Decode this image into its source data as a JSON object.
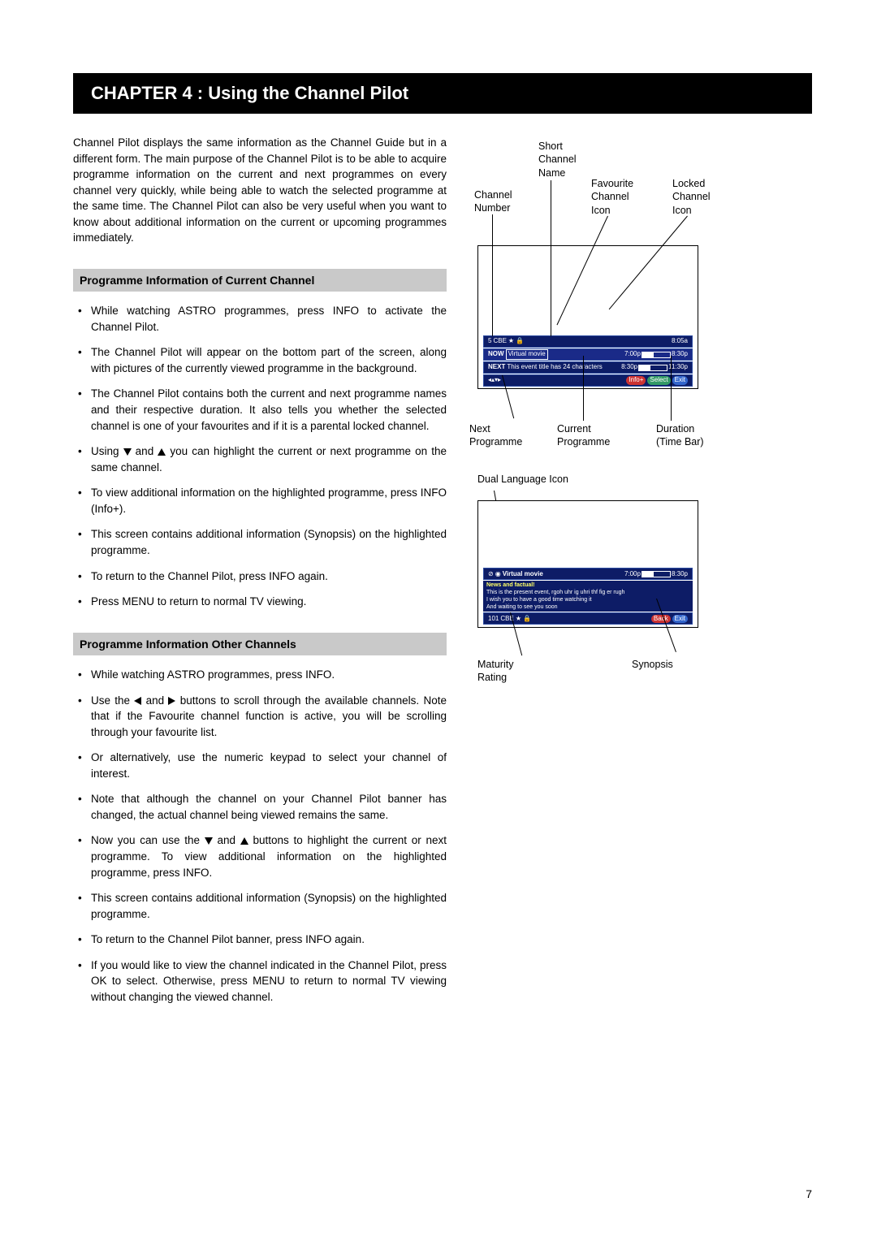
{
  "chapter_title": "CHAPTER 4 : Using the Channel Pilot",
  "intro": "Channel Pilot displays the same information as the Channel Guide but in a different form.  The main purpose of the Channel Pilot is to be able to acquire programme information on the current and next programmes on every channel very quickly, while being able to watch the selected programme at the same time.  The Channel Pilot can also be very useful when you want to know about additional information on the current or upcoming programmes immediately.",
  "section1_title": "Programme Information of Current Channel",
  "section1_items": {
    "i0": "While watching ASTRO programmes, press INFO to activate the Channel Pilot.",
    "i1": "The Channel Pilot will appear on the bottom part of the screen, along with pictures of the currently viewed programme in the background.",
    "i2": "The Channel Pilot contains both the current and next programme names and their respective duration.  It also tells you whether the selected channel is one of your favourites and if it is a parental locked channel.",
    "i3a": "Using ",
    "i3b": " and ",
    "i3c": " you can highlight the current or next programme on the same channel.",
    "i4": "To view additional information on the highlighted programme, press INFO (Info+).",
    "i5": "This screen contains additional information (Synopsis) on the highlighted programme.",
    "i6": "To return to the Channel Pilot, press INFO again.",
    "i7": "Press MENU to return to normal TV viewing."
  },
  "section2_title": "Programme Information Other Channels",
  "section2_items": {
    "i0": "While watching ASTRO programmes, press INFO.",
    "i1a": "Use the  ",
    "i1b": "  and  ",
    "i1c": "  buttons to scroll through the available channels.  Note that if the Favourite channel function is active, you will be scrolling through your favourite list.",
    "i2": "Or alternatively, use the numeric keypad to select your channel of interest.",
    "i3": "Note that although the channel on your Channel Pilot banner has changed, the actual channel being viewed remains the same.",
    "i4a": "Now you can use the ",
    "i4b": " and ",
    "i4c": " buttons to highlight the current or next programme. To view additional information on the highlighted programme, press INFO.",
    "i5": "This screen contains additional information (Synopsis) on the highlighted programme.",
    "i6": "To return to the Channel Pilot banner, press INFO again.",
    "i7": "If you would like to view the channel indicated in the Channel Pilot, press OK to select.  Otherwise, press MENU to return to normal TV viewing without changing the viewed channel."
  },
  "callouts1": {
    "short_name": "Short\nChannel\nName",
    "channel_number": "Channel\nNumber",
    "fav_icon": "Favourite\nChannel\nIcon",
    "locked_icon": "Locked\nChannel\nIcon",
    "next_prog": "Next\nProgramme",
    "current_prog": "Current\nProgramme",
    "duration": "Duration\n(Time Bar)"
  },
  "callouts2": {
    "dual_lang": "Dual Language Icon",
    "maturity": "Maturity\nRating",
    "synopsis": "Synopsis"
  },
  "ui1": {
    "ch_num": "5",
    "ch_name": "CBE",
    "time_top": "8:05a",
    "now_label": "NOW",
    "now_title": "Virtual movie",
    "now_start": "7:00p",
    "now_end": "8:30p",
    "next_label": "NEXT",
    "next_title": "This event title has 24 characters",
    "next_start": "8:30p",
    "next_end": "11:30p",
    "btn_info": "Info+",
    "btn_select": "Select",
    "btn_exit": "Exit"
  },
  "ui2": {
    "title": "Virtual movie",
    "start": "7:00p",
    "end": "8:30p",
    "line1": "News and factual!",
    "line2": "This is the present event, rgoh uhr ig uhri thf fig er rugh",
    "line3": "I wish you to have a good time watching it",
    "line4": "And waiting to see you soon",
    "ch_num": "101",
    "ch_name": "CBE",
    "btn_back": "Back",
    "btn_exit": "Exit"
  },
  "page_number": "7"
}
